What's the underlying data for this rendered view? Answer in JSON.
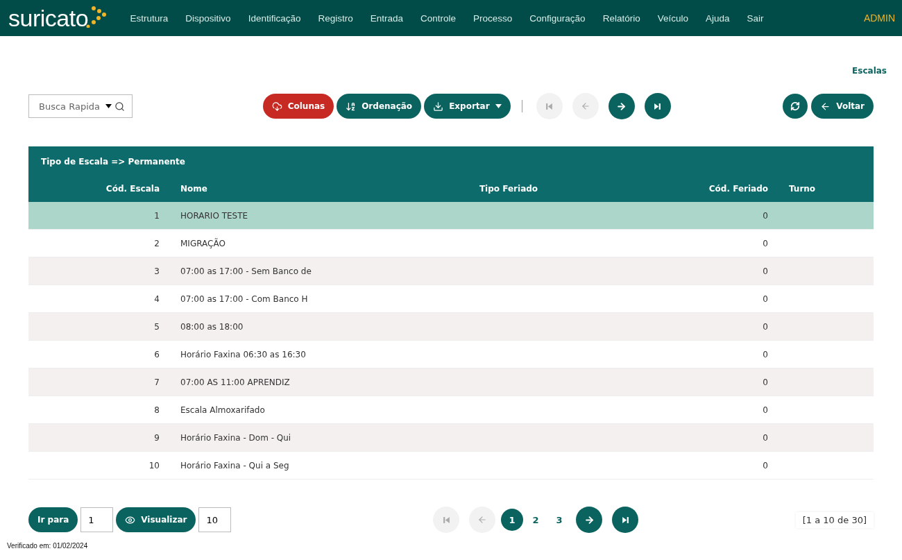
{
  "header": {
    "logo": "suricato",
    "menu": [
      {
        "label": "Estrutura"
      },
      {
        "label": "Dispositivo"
      },
      {
        "label": "Identificação"
      },
      {
        "label": "Registro"
      },
      {
        "label": "Entrada"
      },
      {
        "label": "Controle"
      },
      {
        "label": "Processo"
      },
      {
        "label": "Configuração"
      },
      {
        "label": "Relatório"
      },
      {
        "label": "Veículo"
      },
      {
        "label": "Ajuda"
      },
      {
        "label": "Sair"
      }
    ],
    "user": "ADMIN"
  },
  "breadcrumb": "Escalas",
  "toolbar": {
    "search": {
      "placeholder": "Busca Rapida"
    },
    "buttons": [
      {
        "kind": "columns",
        "label": "Colunas"
      },
      {
        "kind": "sort",
        "label": "Ordenação"
      },
      {
        "kind": "export",
        "label": "Exportar"
      }
    ],
    "nav": [
      {
        "kind": "first",
        "disabled": true
      },
      {
        "kind": "prev",
        "disabled": true
      },
      {
        "kind": "next",
        "disabled": false
      },
      {
        "kind": "last",
        "disabled": false
      }
    ],
    "right": [
      {
        "kind": "refresh"
      },
      {
        "kind": "back",
        "label": "Voltar"
      }
    ]
  },
  "table": {
    "group": "Tipo de Escala => Permanente",
    "columns": [
      "Cód. Escala",
      "Nome",
      "Tipo Feriado",
      "Cód. Feriado",
      "Turno"
    ],
    "rows": [
      {
        "code": "1",
        "name": "HORARIO TESTE",
        "holiday_code": "0",
        "selected": true
      },
      {
        "code": "2",
        "name": "MIGRAÇÃO",
        "holiday_code": "0",
        "selected": false
      },
      {
        "code": "3",
        "name": "07:00 as 17:00 - Sem Banco de",
        "holiday_code": "0",
        "selected": false
      },
      {
        "code": "4",
        "name": "07:00 as 17:00 - Com Banco H",
        "holiday_code": "0",
        "selected": false
      },
      {
        "code": "5",
        "name": "08:00 as 18:00",
        "holiday_code": "0",
        "selected": false
      },
      {
        "code": "6",
        "name": "Horário Faxina 06:30 as 16:30",
        "holiday_code": "0",
        "selected": false
      },
      {
        "code": "7",
        "name": "07:00 AS 11:00 APRENDIZ",
        "holiday_code": "0",
        "selected": false
      },
      {
        "code": "8",
        "name": "Escala Almoxarifado",
        "holiday_code": "0",
        "selected": false
      },
      {
        "code": "9",
        "name": "Horário Faxina - Dom - Qui",
        "holiday_code": "0",
        "selected": false
      },
      {
        "code": "10",
        "name": "Horário Faxina - Qui a Seg",
        "holiday_code": "0",
        "selected": false
      }
    ]
  },
  "footer": {
    "goto": {
      "label": "Ir para",
      "value": "1"
    },
    "view": {
      "label": "Visualizar",
      "value": "10"
    },
    "pagination": {
      "first": {
        "disabled": true
      },
      "prev": {
        "disabled": true
      },
      "pages": [
        {
          "label": "1",
          "selected": true
        },
        {
          "label": "2",
          "selected": false
        },
        {
          "label": "3",
          "selected": false
        }
      ],
      "next": {
        "disabled": false
      },
      "last": {
        "disabled": false
      }
    },
    "range": "[1 a 10 de 30]",
    "verified": "Verificado em: 01/02/2024"
  }
}
